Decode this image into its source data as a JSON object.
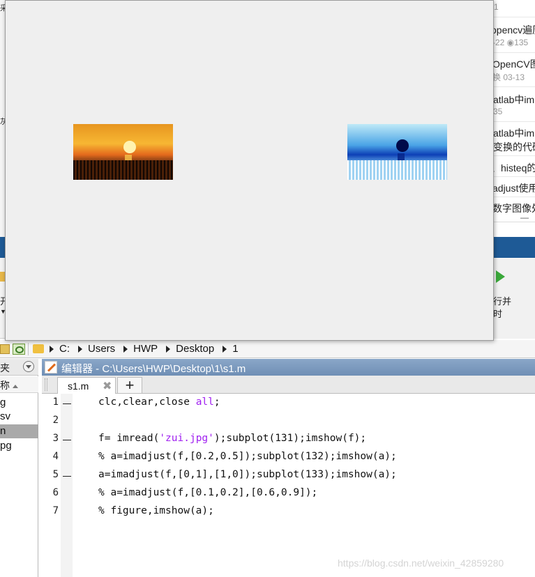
{
  "blog": {
    "top_num": "1",
    "items": [
      {
        "title": "opencv遍历",
        "meta": "-22 ◉135"
      },
      {
        "title": "OpenCV图",
        "meta": "换 03-13"
      },
      {
        "title": "atlab中im",
        "meta": "35"
      },
      {
        "title": "atlab中im",
        "meta": "变换的代码"
      },
      {
        "title": "、histeq的",
        "meta": ""
      },
      {
        "title": "adjust使用",
        "meta": ""
      },
      {
        "title": "数字图像处",
        "meta": ""
      }
    ],
    "dash": "—"
  },
  "leftstrip": {
    "g1": "采",
    "g2": "灰"
  },
  "toolstrip": {
    "left_label": "开",
    "left_arrow": "▼",
    "right_l1": "行并",
    "right_l2": "时"
  },
  "addressbar": {
    "path": [
      "C:",
      "Users",
      "HWP",
      "Desktop",
      "1"
    ]
  },
  "filebrowser": {
    "header": "夹",
    "column_header": "称",
    "files": [
      "g",
      "sv",
      "n",
      "pg"
    ],
    "selected_index": 2
  },
  "editor": {
    "title": "编辑器 - C:\\Users\\HWP\\Desktop\\1\\s1.m",
    "tab_label": "s1.m",
    "tab_close": "✖",
    "plus": "+",
    "lines": [
      {
        "num": "1",
        "dash": true
      },
      {
        "num": "2",
        "dash": false
      },
      {
        "num": "3",
        "dash": true
      },
      {
        "num": "4",
        "dash": false
      },
      {
        "num": "5",
        "dash": true
      },
      {
        "num": "6",
        "dash": false
      },
      {
        "num": "7",
        "dash": false
      }
    ],
    "code": {
      "l1a": "clc,clear,close ",
      "l1b": "all",
      "l1c": ";",
      "l3a": "f= imread(",
      "l3b": "'zui.jpg'",
      "l3c": ");subplot(131);imshow(f);",
      "l4": "% a=imadjust(f,[0.2,0.5]);subplot(132);imshow(a);",
      "l5": "a=imadjust(f,[0,1],[1,0]);subplot(133);imshow(a);",
      "l6": "% a=imadjust(f,[0.1,0.2],[0.6,0.9]);",
      "l7": "% figure,imshow(a);"
    },
    "watermark": "https://blog.csdn.net/weixin_42859280"
  },
  "colors": {
    "band": "#1e5a96",
    "comment": "#228b22",
    "string": "#a020f0"
  }
}
